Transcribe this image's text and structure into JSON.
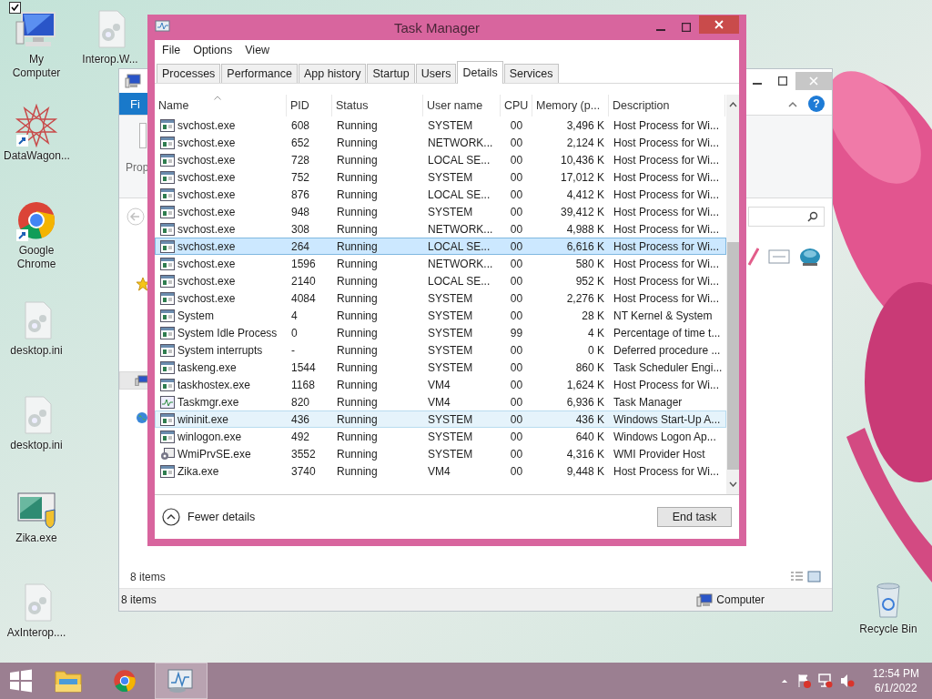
{
  "desktop": {
    "icons": [
      {
        "label": "My Computer",
        "kind": "computer",
        "checked": true,
        "shortcut": false
      },
      {
        "label": "Interop.W...",
        "kind": "config-file",
        "checked": false,
        "shortcut": false
      },
      {
        "label": "DataWagon...",
        "kind": "star-logo",
        "checked": false,
        "shortcut": true
      },
      {
        "label": "Google Chrome",
        "kind": "chrome",
        "checked": false,
        "shortcut": true
      },
      {
        "label": "desktop.ini",
        "kind": "config-file",
        "checked": false,
        "shortcut": false
      },
      {
        "label": "desktop.ini",
        "kind": "config-file",
        "checked": false,
        "shortcut": false
      },
      {
        "label": "Zika.exe",
        "kind": "installer",
        "checked": false,
        "shortcut": false
      },
      {
        "label": "AxInterop....",
        "kind": "config-file",
        "checked": false,
        "shortcut": false
      },
      {
        "label": "Recycle Bin",
        "kind": "recycle-bin",
        "checked": false,
        "shortcut": false
      }
    ]
  },
  "explorer": {
    "ribbon_tab": "Fi",
    "help": "?",
    "ribbon_button": "Prop",
    "item_count": "8 items",
    "status_bar": {
      "items": "8 items",
      "location": "Computer"
    }
  },
  "task_manager": {
    "title": "Task Manager",
    "menu": [
      "File",
      "Options",
      "View"
    ],
    "tabs": [
      {
        "label": "Processes",
        "selected": false
      },
      {
        "label": "Performance",
        "selected": false
      },
      {
        "label": "App history",
        "selected": false
      },
      {
        "label": "Startup",
        "selected": false
      },
      {
        "label": "Users",
        "selected": false
      },
      {
        "label": "Details",
        "selected": true
      },
      {
        "label": "Services",
        "selected": false
      }
    ],
    "columns": [
      {
        "label": "Name",
        "sorted": true
      },
      {
        "label": "PID",
        "sorted": false
      },
      {
        "label": "Status",
        "sorted": false
      },
      {
        "label": "User name",
        "sorted": false
      },
      {
        "label": "CPU",
        "sorted": false
      },
      {
        "label": "Memory (p...",
        "sorted": false
      },
      {
        "label": "Description",
        "sorted": false
      }
    ],
    "rows": [
      {
        "name": "svchost.exe",
        "pid": "608",
        "status": "Running",
        "user_name": "SYSTEM",
        "cpu": "00",
        "memory": "3,496 K",
        "description": "Host Process for Wi...",
        "kind": "service",
        "selected": false,
        "hovered": false
      },
      {
        "name": "svchost.exe",
        "pid": "652",
        "status": "Running",
        "user_name": "NETWORK...",
        "cpu": "00",
        "memory": "2,124 K",
        "description": "Host Process for Wi...",
        "kind": "service",
        "selected": false,
        "hovered": false
      },
      {
        "name": "svchost.exe",
        "pid": "728",
        "status": "Running",
        "user_name": "LOCAL SE...",
        "cpu": "00",
        "memory": "10,436 K",
        "description": "Host Process for Wi...",
        "kind": "service",
        "selected": false,
        "hovered": false
      },
      {
        "name": "svchost.exe",
        "pid": "752",
        "status": "Running",
        "user_name": "SYSTEM",
        "cpu": "00",
        "memory": "17,012 K",
        "description": "Host Process for Wi...",
        "kind": "service",
        "selected": false,
        "hovered": false
      },
      {
        "name": "svchost.exe",
        "pid": "876",
        "status": "Running",
        "user_name": "LOCAL SE...",
        "cpu": "00",
        "memory": "4,412 K",
        "description": "Host Process for Wi...",
        "kind": "service",
        "selected": false,
        "hovered": false
      },
      {
        "name": "svchost.exe",
        "pid": "948",
        "status": "Running",
        "user_name": "SYSTEM",
        "cpu": "00",
        "memory": "39,412 K",
        "description": "Host Process for Wi...",
        "kind": "service",
        "selected": false,
        "hovered": false
      },
      {
        "name": "svchost.exe",
        "pid": "308",
        "status": "Running",
        "user_name": "NETWORK...",
        "cpu": "00",
        "memory": "4,988 K",
        "description": "Host Process for Wi...",
        "kind": "service",
        "selected": false,
        "hovered": false
      },
      {
        "name": "svchost.exe",
        "pid": "264",
        "status": "Running",
        "user_name": "LOCAL SE...",
        "cpu": "00",
        "memory": "6,616 K",
        "description": "Host Process for Wi...",
        "kind": "service",
        "selected": true,
        "hovered": false
      },
      {
        "name": "svchost.exe",
        "pid": "1596",
        "status": "Running",
        "user_name": "NETWORK...",
        "cpu": "00",
        "memory": "580 K",
        "description": "Host Process for Wi...",
        "kind": "service",
        "selected": false,
        "hovered": false
      },
      {
        "name": "svchost.exe",
        "pid": "2140",
        "status": "Running",
        "user_name": "LOCAL SE...",
        "cpu": "00",
        "memory": "952 K",
        "description": "Host Process for Wi...",
        "kind": "service",
        "selected": false,
        "hovered": false
      },
      {
        "name": "svchost.exe",
        "pid": "4084",
        "status": "Running",
        "user_name": "SYSTEM",
        "cpu": "00",
        "memory": "2,276 K",
        "description": "Host Process for Wi...",
        "kind": "service",
        "selected": false,
        "hovered": false
      },
      {
        "name": "System",
        "pid": "4",
        "status": "Running",
        "user_name": "SYSTEM",
        "cpu": "00",
        "memory": "28 K",
        "description": "NT Kernel & System",
        "kind": "service",
        "selected": false,
        "hovered": false
      },
      {
        "name": "System Idle Process",
        "pid": "0",
        "status": "Running",
        "user_name": "SYSTEM",
        "cpu": "99",
        "memory": "4 K",
        "description": "Percentage of time t...",
        "kind": "service",
        "selected": false,
        "hovered": false
      },
      {
        "name": "System interrupts",
        "pid": "-",
        "status": "Running",
        "user_name": "SYSTEM",
        "cpu": "00",
        "memory": "0 K",
        "description": "Deferred procedure ...",
        "kind": "service",
        "selected": false,
        "hovered": false
      },
      {
        "name": "taskeng.exe",
        "pid": "1544",
        "status": "Running",
        "user_name": "SYSTEM",
        "cpu": "00",
        "memory": "860 K",
        "description": "Task Scheduler Engi...",
        "kind": "service",
        "selected": false,
        "hovered": false
      },
      {
        "name": "taskhostex.exe",
        "pid": "1168",
        "status": "Running",
        "user_name": "VM4",
        "cpu": "00",
        "memory": "1,624 K",
        "description": "Host Process for Wi...",
        "kind": "service",
        "selected": false,
        "hovered": false
      },
      {
        "name": "Taskmgr.exe",
        "pid": "820",
        "status": "Running",
        "user_name": "VM4",
        "cpu": "00",
        "memory": "6,936 K",
        "description": "Task Manager",
        "kind": "monitor",
        "selected": false,
        "hovered": false
      },
      {
        "name": "wininit.exe",
        "pid": "436",
        "status": "Running",
        "user_name": "SYSTEM",
        "cpu": "00",
        "memory": "436 K",
        "description": "Windows Start-Up A...",
        "kind": "service",
        "selected": false,
        "hovered": true
      },
      {
        "name": "winlogon.exe",
        "pid": "492",
        "status": "Running",
        "user_name": "SYSTEM",
        "cpu": "00",
        "memory": "640 K",
        "description": "Windows Logon Ap...",
        "kind": "service",
        "selected": false,
        "hovered": false
      },
      {
        "name": "WmiPrvSE.exe",
        "pid": "3552",
        "status": "Running",
        "user_name": "SYSTEM",
        "cpu": "00",
        "memory": "4,316 K",
        "description": "WMI Provider Host",
        "kind": "gears",
        "selected": false,
        "hovered": false
      },
      {
        "name": "Zika.exe",
        "pid": "3740",
        "status": "Running",
        "user_name": "VM4",
        "cpu": "00",
        "memory": "9,448 K",
        "description": "Host Process for Wi...",
        "kind": "service",
        "selected": false,
        "hovered": false
      }
    ],
    "fewer_details": "Fewer details",
    "end_task": "End task"
  },
  "taskbar": {
    "apps": [
      {
        "kind": "explorer",
        "active": false
      },
      {
        "kind": "chrome",
        "active": false
      },
      {
        "kind": "task-manager",
        "active": true
      }
    ],
    "clock": {
      "time": "12:54 PM",
      "date": "6/1/2022"
    }
  }
}
